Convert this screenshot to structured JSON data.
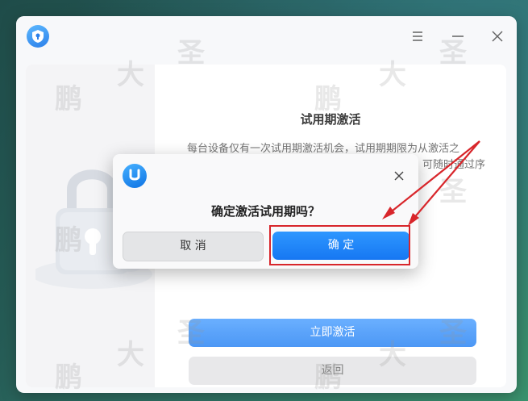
{
  "window": {
    "menu_icon": "hamburger-menu-icon",
    "minimize_icon": "minimize-icon",
    "close_icon": "close-icon",
    "app_icon": "shield-logo-icon"
  },
  "panel": {
    "title": "试用期激活",
    "description_line1": "每台设备仅有一次试用期激活机会，试用期期限为从激活之",
    "description_line2": "可随时通过序",
    "activate_button": "立即激活",
    "back_button": "返回"
  },
  "dialog": {
    "logo_icon": "uos-logo-icon",
    "close_icon": "close-icon",
    "question": "确定激活试用期吗？",
    "cancel_label": "取 消",
    "confirm_label": "确 定"
  },
  "watermark": {
    "chars": [
      "鹏",
      "大",
      "圣"
    ]
  },
  "colors": {
    "accent": "#3d8ff5",
    "confirm": "#1677f2",
    "annotation": "#d8262b"
  }
}
